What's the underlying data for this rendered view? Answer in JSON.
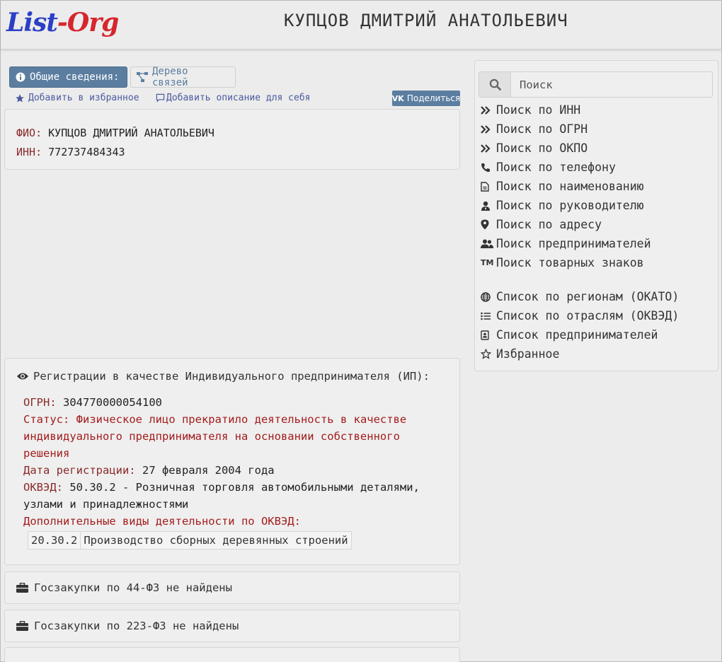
{
  "header": {
    "logo_part1": "List",
    "logo_sep": "-",
    "logo_part2": "Org",
    "title": "КУПЦОВ ДМИТРИЙ АНАТОЛЬЕВИЧ"
  },
  "tabs": [
    {
      "label": "Общие сведения:",
      "icon": "info-icon",
      "active": true
    },
    {
      "label": "Дерево связей",
      "icon": "tree-icon",
      "active": false
    }
  ],
  "actions": {
    "favorite": "Добавить в избранное",
    "description": "Добавить описание для себя",
    "share": "Поделиться"
  },
  "info": {
    "fio_label": "ФИО:",
    "fio_value": "КУПЦОВ ДМИТРИЙ АНАТОЛЬЕВИЧ",
    "inn_label": "ИНН:",
    "inn_value": "772737484343"
  },
  "registration": {
    "heading": "Регистрации в качестве Индивидуального предпринимателя (ИП):",
    "ogrn_label": "ОГРН:",
    "ogrn_value": "304770000054100",
    "status_label": "Статус:",
    "status_line1": "Физическое лицо прекратило деятельность в качестве",
    "status_line2": "индивидуального предпринимателя на основании собственного",
    "status_line3": "решения",
    "date_label": "Дата регистрации:",
    "date_value": "27 февраля 2004 года",
    "okved_label": "ОКВЭД:",
    "okved_line1": "50.30.2 - Розничная торговля автомобильными деталями,",
    "okved_line2": "узлами и принадлежностями",
    "extra_label": "Дополнительные виды деятельности по ОКВЭД:",
    "extra": [
      {
        "code": "20.30.2",
        "name": "Производство сборных деревянных строений"
      }
    ]
  },
  "procurement": {
    "fz44": "Госзакупки по 44-ФЗ не найдены",
    "fz223": "Госзакупки по 223-ФЗ не найдены"
  },
  "sidebar": {
    "search_placeholder": "Поиск",
    "items": [
      {
        "label": "Поиск по ИНН",
        "icon": "double-chevron-icon"
      },
      {
        "label": "Поиск по ОГРН",
        "icon": "double-chevron-icon"
      },
      {
        "label": "Поиск по ОКПО",
        "icon": "double-chevron-icon"
      },
      {
        "label": "Поиск по телефону",
        "icon": "phone-icon"
      },
      {
        "label": "Поиск по наименованию",
        "icon": "document-icon"
      },
      {
        "label": "Поиск по руководителю",
        "icon": "user-tie-icon"
      },
      {
        "label": "Поиск по адресу",
        "icon": "map-marker-icon"
      },
      {
        "label": "Поиск предпринимателей",
        "icon": "users-icon"
      },
      {
        "label": "Поиск товарных знаков",
        "icon": "trademark-icon"
      }
    ],
    "items2": [
      {
        "label": "Список по регионам (ОКАТО)",
        "icon": "globe-icon"
      },
      {
        "label": "Список по отраслям (ОКВЭД)",
        "icon": "list-icon"
      },
      {
        "label": "Список предпринимателей",
        "icon": "contact-card-icon"
      },
      {
        "label": "Избранное",
        "icon": "star-outline-icon"
      }
    ],
    "trademark_glyph": "TM"
  }
}
